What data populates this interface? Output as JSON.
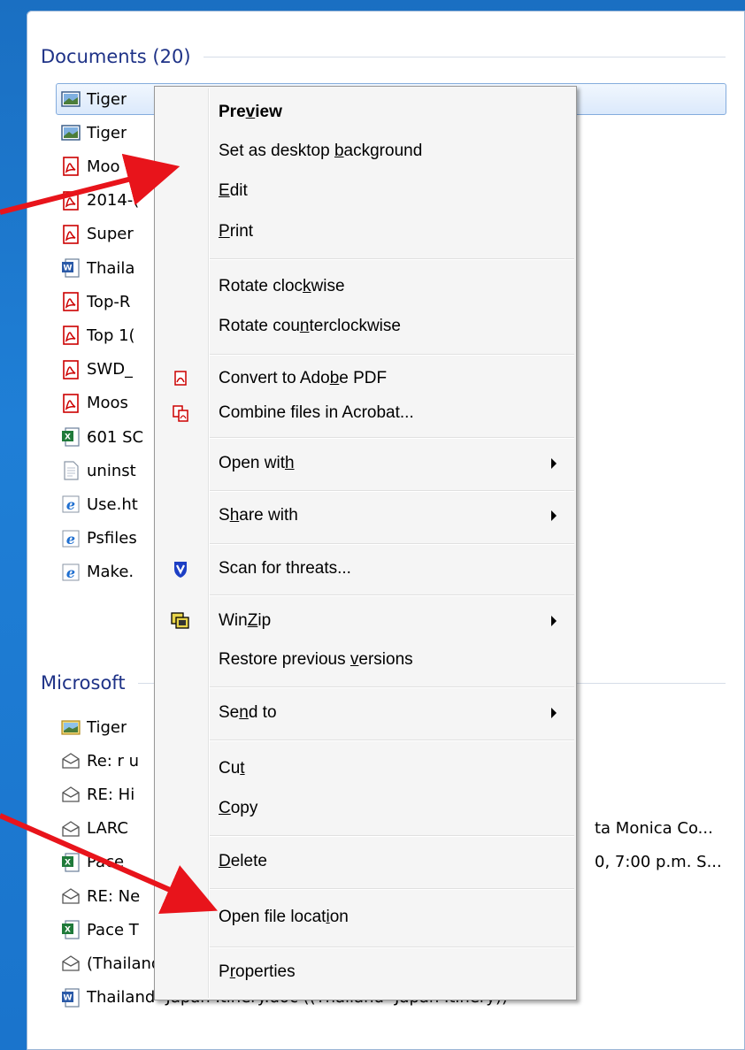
{
  "documents_header": "Documents (20)",
  "microsoft_header": "Microsoft",
  "documents": [
    {
      "icon": "image",
      "name": "Tiger",
      "selected": true
    },
    {
      "icon": "image",
      "name": "Tiger"
    },
    {
      "icon": "pdf",
      "name": "Moo"
    },
    {
      "icon": "pdf",
      "name": "2014-("
    },
    {
      "icon": "pdf",
      "name": "Super"
    },
    {
      "icon": "word",
      "name": "Thaila"
    },
    {
      "icon": "pdf",
      "name": "Top-R"
    },
    {
      "icon": "pdf",
      "name": "Top 1("
    },
    {
      "icon": "pdf",
      "name": "SWD_"
    },
    {
      "icon": "pdf",
      "name": "Moos"
    },
    {
      "icon": "excel",
      "name": "601 SC"
    },
    {
      "icon": "text",
      "name": "uninst"
    },
    {
      "icon": "ie",
      "name": "Use.ht"
    },
    {
      "icon": "ie",
      "name": "Psfiles"
    },
    {
      "icon": "ie",
      "name": "Make."
    }
  ],
  "microsoft_items": [
    {
      "icon": "image-mail",
      "name": "Tiger",
      "tail": ""
    },
    {
      "icon": "mail",
      "name": "Re: r u",
      "tail": ""
    },
    {
      "icon": "mail",
      "name": "RE: Hi",
      "tail": ""
    },
    {
      "icon": "mail",
      "name": "LARC",
      "tail": "ta Monica Co..."
    },
    {
      "icon": "excel",
      "name": "Pace",
      "tail": "0, 7:00 p.m. S..."
    },
    {
      "icon": "mail",
      "name": "RE: Ne",
      "tail": ""
    },
    {
      "icon": "excel",
      "name": "Pace T",
      "tail": ""
    },
    {
      "icon": "mail",
      "name": "(Thailand- Japan Itinery)",
      "tail": ""
    },
    {
      "icon": "word",
      "name": "Thailand- Japan Itinery.doc ((Thailand- Japan Itinery))",
      "tail": ""
    }
  ],
  "menu": {
    "preview": {
      "pre": "Pre",
      "acc": "v",
      "post": "iew"
    },
    "set_bg": {
      "pre": "Set as desktop ",
      "acc": "b",
      "post": "ackground"
    },
    "edit": {
      "pre": "",
      "acc": "E",
      "post": "dit"
    },
    "print": {
      "pre": "",
      "acc": "P",
      "post": "rint"
    },
    "rotate_cw": {
      "pre": "Rotate cloc",
      "acc": "k",
      "post": "wise"
    },
    "rotate_ccw": {
      "pre": "Rotate cou",
      "acc": "n",
      "post": "terclockwise"
    },
    "convert_pdf": {
      "pre": "Convert to Ado",
      "acc": "b",
      "post": "e PDF"
    },
    "combine": {
      "pre": "Combine files in Acrobat...",
      "acc": "",
      "post": ""
    },
    "open_with": {
      "pre": "Open wit",
      "acc": "h",
      "post": ""
    },
    "share_with": {
      "pre": "S",
      "acc": "h",
      "post": "are with"
    },
    "scan": {
      "pre": "Scan for threats...",
      "acc": "",
      "post": ""
    },
    "winzip": {
      "pre": "Win",
      "acc": "Z",
      "post": "ip"
    },
    "restore": {
      "pre": "Restore previous ",
      "acc": "v",
      "post": "ersions"
    },
    "send_to": {
      "pre": "Se",
      "acc": "n",
      "post": "d to"
    },
    "cut": {
      "pre": "Cu",
      "acc": "t",
      "post": ""
    },
    "copy": {
      "pre": "",
      "acc": "C",
      "post": "opy"
    },
    "delete": {
      "pre": "",
      "acc": "D",
      "post": "elete"
    },
    "open_location": {
      "pre": "Open file locat",
      "acc": "i",
      "post": "on"
    },
    "properties": {
      "pre": "P",
      "acc": "r",
      "post": "operties"
    }
  },
  "colors": {
    "annotation_arrow": "#e8141b",
    "header_text": "#1e3287"
  }
}
